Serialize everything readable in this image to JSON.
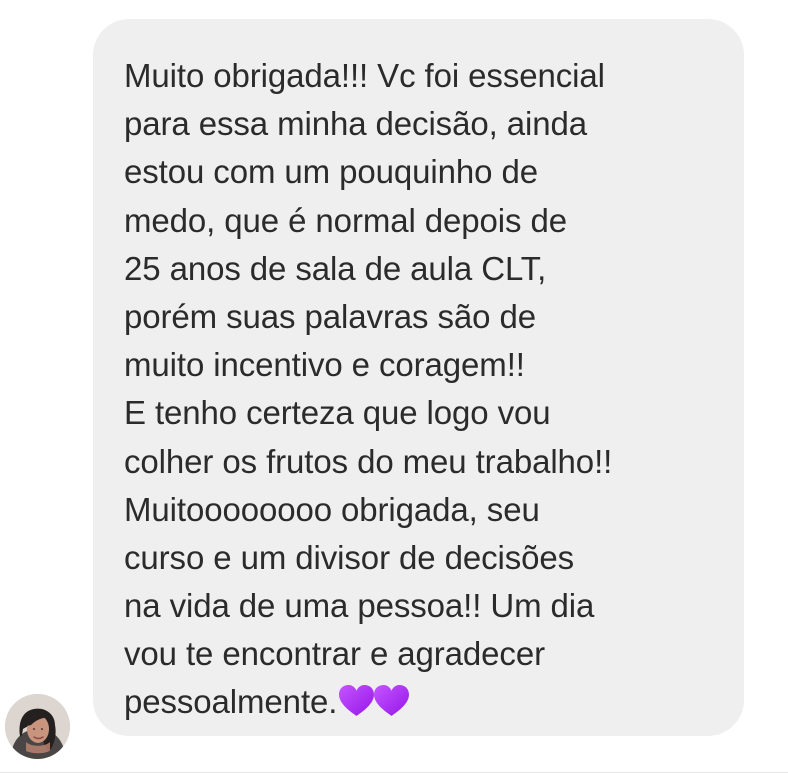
{
  "conversation": {
    "message": {
      "lines": [
        "Muito obrigada!!! Vc foi essencial",
        "para essa minha decisão, ainda",
        "estou com um pouquinho de",
        "medo, que é normal depois de",
        "25 anos de sala de aula CLT,",
        "porém suas palavras são de",
        "muito incentivo e coragem!!",
        "E tenho certeza que logo vou",
        "colher os frutos do meu trabalho!!",
        "Muitoooooooo obrigada, seu",
        "curso e um divisor de decisões",
        "na vida de uma pessoa!! Um dia",
        "vou te encontrar e agradecer",
        "pessoalmente."
      ],
      "emoji": [
        "purple-heart-icon",
        "purple-heart-icon"
      ]
    },
    "sender": {
      "avatar": "profile-photo-avatar"
    }
  },
  "colors": {
    "bubble_background": "#efefef",
    "message_text": "#2b2b2b",
    "heart_purple": "#a925f4",
    "page_background": "#ffffff"
  }
}
